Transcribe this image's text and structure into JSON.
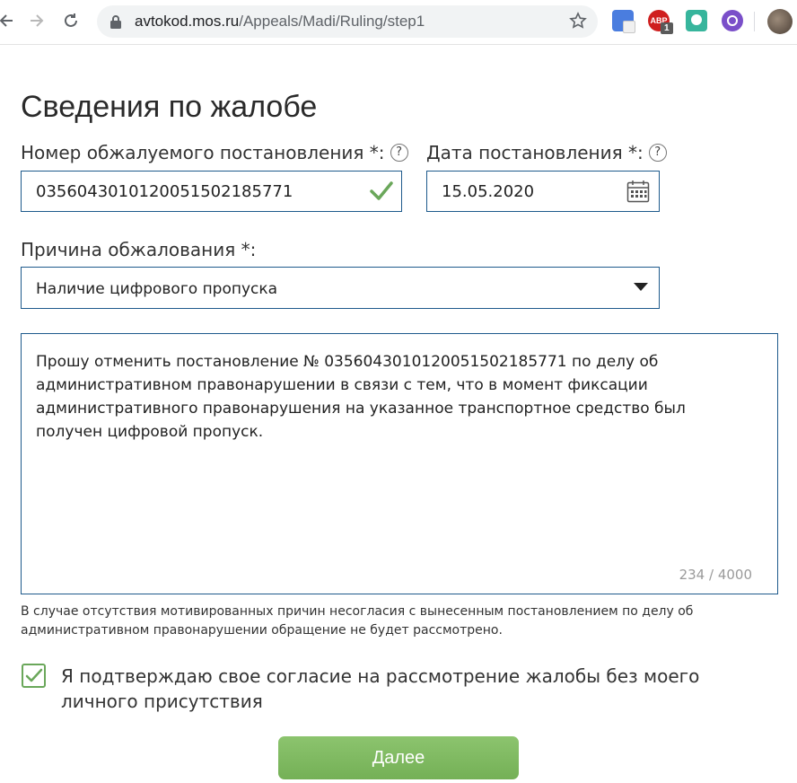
{
  "browser": {
    "url_host": "avtokod.mos.ru",
    "url_path": "/Appeals/Madi/Ruling/step1",
    "extensions": {
      "abp_label": "ABP",
      "abp_badge": "1"
    }
  },
  "page": {
    "title": "Сведения по жалобе"
  },
  "form": {
    "ruling_number": {
      "label": "Номер обжалуемого постановления *:",
      "help": "?",
      "value": "0356043010120051502185771"
    },
    "ruling_date": {
      "label": "Дата постановления *:",
      "help": "?",
      "value": "15.05.2020"
    },
    "reason": {
      "label": "Причина обжалования *:",
      "selected": "Наличие цифрового пропуска"
    },
    "complaint_text": {
      "value": "Прошу отменить постановление № 0356043010120051502185771 по делу об административном правонарушении в связи с тем, что в момент фиксации административного правонарушения на указанное транспортное средство был получен цифровой пропуск.",
      "counter": "234 / 4000"
    },
    "hint": "В случае отсутствия мотивированных причин несогласия с вынесенным постановлением по делу об административном правонарушении обращение не будет рассмотрено.",
    "consent": {
      "checked": true,
      "label": "Я подтверждаю свое согласие на рассмотрение жалобы без моего личного присутствия"
    },
    "next_button": "Далее"
  },
  "colors": {
    "accent_green": "#6aa75a",
    "field_border": "#1e5a8c",
    "button_green": "#7cb55e"
  }
}
